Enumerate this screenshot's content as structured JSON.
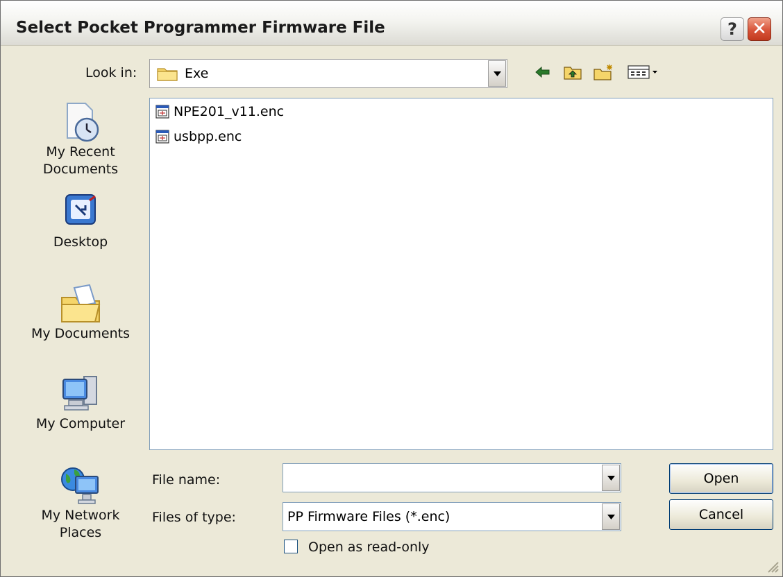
{
  "window": {
    "title": "Select Pocket Programmer Firmware File",
    "help_glyph": "?",
    "close_glyph": "✕"
  },
  "lookin": {
    "label": "Look in:",
    "value": "Exe",
    "icon": "folder-icon"
  },
  "toolbar": {
    "icons": [
      "back-arrow-icon",
      "up-folder-icon",
      "new-folder-icon",
      "views-menu-icon"
    ]
  },
  "places": [
    {
      "label": "My Recent\nDocuments",
      "icon": "recent-documents-icon"
    },
    {
      "label": "Desktop",
      "icon": "desktop-icon"
    },
    {
      "label": "My Documents",
      "icon": "my-documents-icon"
    },
    {
      "label": "My Computer",
      "icon": "my-computer-icon"
    },
    {
      "label": "My Network\nPlaces",
      "icon": "network-places-icon"
    }
  ],
  "files": [
    {
      "name": "NPE201_v11.enc",
      "icon": "enc-file-icon"
    },
    {
      "name": "usbpp.enc",
      "icon": "enc-file-icon"
    }
  ],
  "form": {
    "filename_label": "File name:",
    "filename_value": "",
    "filetype_label": "Files of type:",
    "filetype_value": "PP Firmware Files (*.enc)",
    "readonly_label": "Open as read-only",
    "readonly_checked": false
  },
  "buttons": {
    "open": "Open",
    "cancel": "Cancel"
  },
  "colors": {
    "dialog_bg": "#ece9d8",
    "close_red": "#d8543a",
    "field_border": "#7f9db9"
  }
}
